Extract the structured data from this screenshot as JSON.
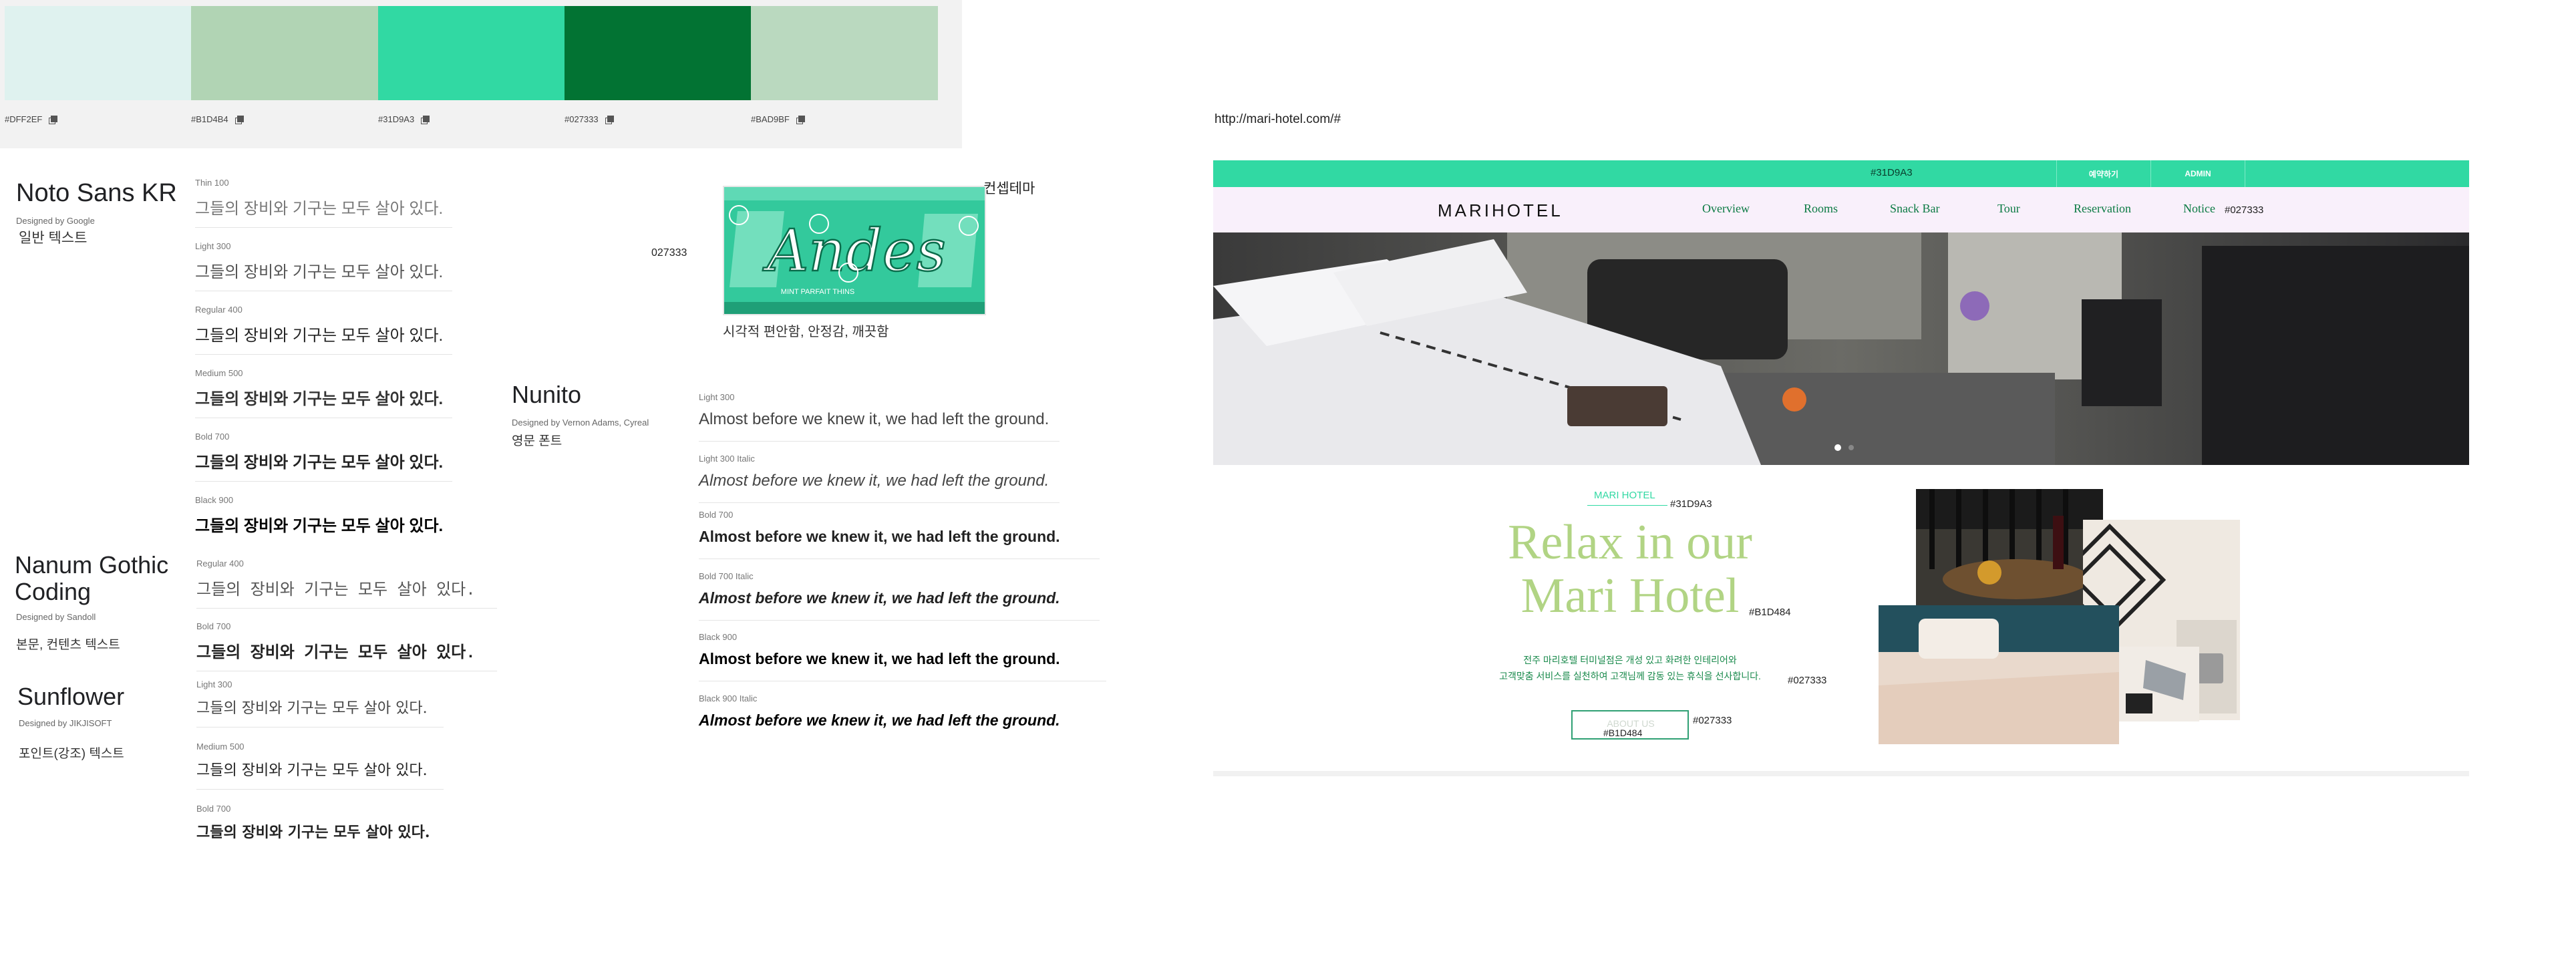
{
  "palette": {
    "swatches": [
      {
        "hex": "#DFF2EF",
        "label": "#DFF2EF"
      },
      {
        "hex": "#B1D4B4",
        "label": "#B1D4B4"
      },
      {
        "hex": "#31D9A3",
        "label": "#31D9A3"
      },
      {
        "hex": "#027333",
        "label": "#027333"
      },
      {
        "hex": "#BAD9BF",
        "label": "#BAD9BF"
      }
    ]
  },
  "fonts": {
    "noto": {
      "name": "Noto Sans KR",
      "designer": "Designed by Google",
      "note": "일반 텍스트",
      "weights": [
        "Thin 100",
        "Light 300",
        "Regular 400",
        "Medium 500",
        "Bold 700",
        "Black 900"
      ],
      "sample": "그들의 장비와 기구는 모두 살아 있다."
    },
    "nanum": {
      "name": "Nanum Gothic Coding",
      "designer": "Designed by Sandoll",
      "note": "본문, 컨텐츠 텍스트",
      "weights": [
        "Regular 400",
        "Bold 700"
      ],
      "sample": "그들의 장비와 기구는 모두 살아 있다."
    },
    "sunflower": {
      "name": "Sunflower",
      "designer": "Designed by JIKJISOFT",
      "note": "포인트(강조) 텍스트",
      "weights": [
        "Light 300",
        "Medium 500",
        "Bold 700"
      ],
      "sample": "그들의 장비와 기구는 모두 살아 있다."
    },
    "nunito": {
      "name": "Nunito",
      "designer": "Designed by Vernon Adams, Cyreal",
      "note": "영문 폰트",
      "weights": [
        "Light 300",
        "Light 300 Italic",
        "Bold 700",
        "Bold 700 Italic",
        "Black 900",
        "Black 900 Italic"
      ],
      "sample": "Almost before we knew it, we had left the ground."
    }
  },
  "andes": {
    "brand": "Andes",
    "subtitle": "MINT PARFAIT THINS",
    "concept_title": "컨셉테마",
    "caption": "시각적 편안함, 안정감, 깨끗함",
    "hex_note": "027333"
  },
  "hotel": {
    "url": "http://mari-hotel.com/#",
    "topbar": {
      "hex_note": "#31D9A3",
      "reserve": "예약하기",
      "admin": "ADMIN"
    },
    "logo": "MARIHOTEL",
    "nav": [
      "Overview",
      "Rooms",
      "Snack Bar",
      "Tour",
      "Reservation",
      "Notice"
    ],
    "nav_hex_note": "#027333",
    "intro": {
      "label": "MARI HOTEL",
      "label_hex_note": "#31D9A3",
      "headline_line1": "Relax in our",
      "headline_line2": "Mari Hotel",
      "headline_hex_note": "#B1D484",
      "body_line1": "전주 마리호텔 터미널점은 개성 있고 화려한 인테리어와",
      "body_line2": "고객맞춤 서비스를 실천하여 고객님께 감동 있는 휴식을 선사합니다.",
      "body_hex_note": "#027333",
      "button": "ABOUT US",
      "button_hex_note": "#027333",
      "button_text_hex_note": "#B1D484"
    }
  }
}
